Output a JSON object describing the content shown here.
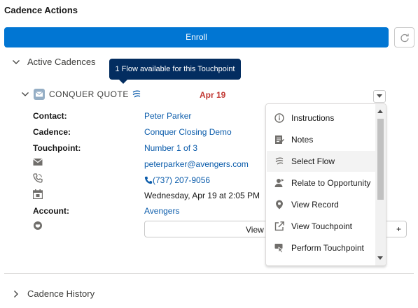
{
  "header": {
    "title": "Cadence Actions"
  },
  "enroll": {
    "label": "Enroll"
  },
  "active": {
    "label": "Active Cadences"
  },
  "tooltip": {
    "text": "1 Flow available for this Touchpoint"
  },
  "cadence": {
    "title": "CONQUER QUOTE",
    "due": "Apr 19",
    "contact_label": "Contact:",
    "contact_value": "Peter Parker",
    "cadence_label": "Cadence:",
    "cadence_value": "Conquer Closing Demo",
    "touchpoint_label": "Touchpoint:",
    "touchpoint_value": "Number 1 of 3",
    "email": "peterparker@avengers.com",
    "phone": "(737) 207-9056",
    "datetime": "Wednesday, Apr 19 at 2:05 PM",
    "account_label": "Account:",
    "account_value": "Avengers",
    "view_button_label": "View I",
    "view_button_plus": "+"
  },
  "menu": {
    "items": [
      {
        "label": "Instructions",
        "icon": "info-icon"
      },
      {
        "label": "Notes",
        "icon": "notes-icon"
      },
      {
        "label": "Select Flow",
        "icon": "flow-icon"
      },
      {
        "label": "Relate to Opportunity",
        "icon": "relate-icon"
      },
      {
        "label": "View Record",
        "icon": "record-icon"
      },
      {
        "label": "View Touchpoint",
        "icon": "external-link-icon"
      },
      {
        "label": "Perform Touchpoint",
        "icon": "perform-icon"
      }
    ]
  },
  "history": {
    "label": "Cadence History"
  },
  "colors": {
    "brand": "#0176d3",
    "link": "#0b5cab",
    "due": "#c23934",
    "tooltip": "#032d60"
  }
}
